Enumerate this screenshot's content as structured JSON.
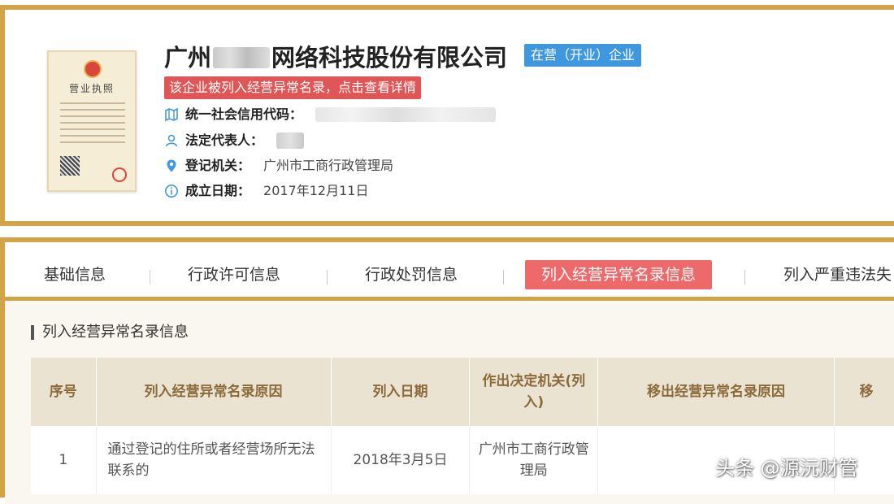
{
  "company": {
    "license_title": "营业执照",
    "name_prefix": "广州",
    "name_suffix": "网络科技股份有限公司",
    "status_badge": "在营（开业）企业",
    "alert": "该企业被列入经营异常名录，点击查看详情",
    "credit_code_label": "统一社会信用代码：",
    "legal_rep_label": "法定代表人：",
    "registry_label": "登记机关：",
    "registry_value": "广州市工商行政管理局",
    "founded_label": "成立日期：",
    "founded_value": "2017年12月11日"
  },
  "tabs": [
    {
      "label": "基础信息"
    },
    {
      "label": "行政许可信息"
    },
    {
      "label": "行政处罚信息"
    },
    {
      "label": "列入经营异常名录信息"
    },
    {
      "label": "列入严重违法失"
    }
  ],
  "section": {
    "title": "列入经营异常名录信息",
    "columns": [
      "序号",
      "列入经营异常名录原因",
      "列入日期",
      "作出决定机关(列入)",
      "移出经营异常名录原因",
      "移"
    ],
    "rows": [
      {
        "index": "1",
        "reason": "通过登记的住所或者经营场所无法联系的",
        "date": "2018年3月5日",
        "authority": "广州市工商行政管理局",
        "removal_reason": "",
        "removal": ""
      }
    ]
  },
  "watermark": "头条 @源沅财管",
  "colors": {
    "gold": "#d1a448",
    "blue": "#3f97dd",
    "red": "#e05555",
    "active_tab": "#ee6a6a",
    "header_bg": "#ebe3d2"
  }
}
